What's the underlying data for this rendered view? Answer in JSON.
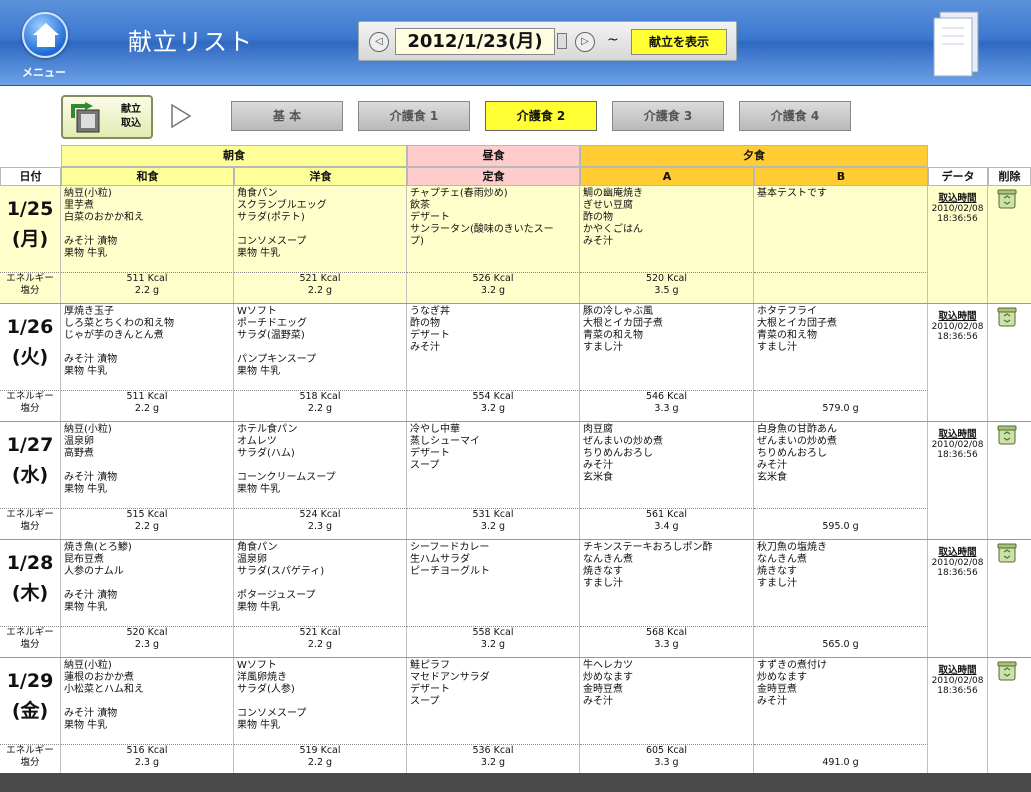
{
  "header": {
    "menu_label": "メニュー",
    "title": "献立リスト",
    "date": "2012/1/23(月)",
    "tilde": "~",
    "show_button": "献立を表示"
  },
  "toolbar": {
    "import_label_1": "献立",
    "import_label_2": "取込",
    "tabs": [
      "基 本",
      "介護食 1",
      "介護食 2",
      "介護食 3",
      "介護食 4"
    ],
    "active_tab": "介護食 2"
  },
  "table_headers": {
    "breakfast": "朝食",
    "lunch": "昼食",
    "dinner": "夕食",
    "date_col": "日付",
    "japanese": "和食",
    "western": "洋食",
    "set_meal": "定食",
    "a": "A",
    "b": "B",
    "data": "データ",
    "delete": "削除",
    "energy": "エネルギー",
    "salt": "塩分",
    "import_time": "取込時間"
  },
  "colors": {
    "breakfast_bg": "#ffff99",
    "lunch_bg": "#ffcccc",
    "dinner_bg": "#ffcc33",
    "highlight_row": "#ffffcc",
    "active_tab": "#ffff33"
  },
  "days": [
    {
      "date": "1/25",
      "weekday": "(月)",
      "highlight": true,
      "japanese": "納豆(小粒)\n里芋煮\n白菜のおかか和え\n\nみそ汁 漬物\n果物 牛乳",
      "western": "角食パン\nスクランブルエッグ\nサラダ(ポテト)\n\nコンソメスープ\n果物 牛乳",
      "set_meal": "チャプチェ(春雨炒め)\n飲茶\nデザート\nサンラータン(酸味のきいたスー\nプ)",
      "a": "鯛の幽庵焼き\nぎせい豆腐\n酢の物\nかやくごはん\nみそ汁",
      "b": "基本テストです",
      "energy": [
        "511 Kcal",
        "521 Kcal",
        "526 Kcal",
        "520 Kcal",
        ""
      ],
      "salt": [
        "2.2 g",
        "2.2 g",
        "3.2 g",
        "3.5 g",
        ""
      ],
      "import_date": "2010/02/08",
      "import_time": "18:36:56"
    },
    {
      "date": "1/26",
      "weekday": "(火)",
      "highlight": false,
      "japanese": "厚焼き玉子\nしろ菜とちくわの和え物\nじゃが芋のきんとん煮\n\nみそ汁 漬物\n果物 牛乳",
      "western": "Wソフト\nポーチドエッグ\nサラダ(温野菜)\n\nパンプキンスープ\n果物 牛乳",
      "set_meal": "うなぎ丼\n酢の物\nデザート\nみそ汁",
      "a": "豚の冷しゃぶ風\n大根とイカ団子煮\n青菜の和え物\nすまし汁",
      "b": "ホタテフライ\n大根とイカ団子煮\n青菜の和え物\nすまし汁",
      "energy": [
        "511 Kcal",
        "518 Kcal",
        "554 Kcal",
        "546 Kcal",
        ""
      ],
      "salt": [
        "2.2 g",
        "2.2 g",
        "3.2 g",
        "3.3 g",
        "579.0 g"
      ],
      "import_date": "2010/02/08",
      "import_time": "18:36:56"
    },
    {
      "date": "1/27",
      "weekday": "(水)",
      "highlight": false,
      "japanese": "納豆(小粒)\n温泉卵\n高野煮\n\nみそ汁 漬物\n果物 牛乳",
      "western": "ホテル食パン\nオムレツ\nサラダ(ハム)\n\nコーンクリームスープ\n果物 牛乳",
      "set_meal": "冷やし中華\n蒸しシューマイ\nデザート\nスープ",
      "a": "肉豆腐\nぜんまいの炒め煮\nちりめんおろし\nみそ汁\n玄米食",
      "b": "白身魚の甘酢あん\nぜんまいの炒め煮\nちりめんおろし\nみそ汁\n玄米食",
      "energy": [
        "515 Kcal",
        "524 Kcal",
        "531 Kcal",
        "561 Kcal",
        ""
      ],
      "salt": [
        "2.2 g",
        "2.3 g",
        "3.2 g",
        "3.4 g",
        "595.0 g"
      ],
      "import_date": "2010/02/08",
      "import_time": "18:36:56"
    },
    {
      "date": "1/28",
      "weekday": "(木)",
      "highlight": false,
      "japanese": "焼き魚(とろ鯵)\n昆布豆煮\n人参のナムル\n\nみそ汁 漬物\n果物 牛乳",
      "western": "角食パン\n温泉卵\nサラダ(スパゲティ)\n\nポタージュスープ\n果物 牛乳",
      "set_meal": "シーフードカレー\n生ハムサラダ\nピーチヨーグルト",
      "a": "チキンステーキおろしポン酢\nなんきん煮\n焼きなす\nすまし汁",
      "b": "秋刀魚の塩焼き\nなんきん煮\n焼きなす\nすまし汁",
      "energy": [
        "520 Kcal",
        "521 Kcal",
        "558 Kcal",
        "568 Kcal",
        ""
      ],
      "salt": [
        "2.3 g",
        "2.2 g",
        "3.2 g",
        "3.3 g",
        "565.0 g"
      ],
      "import_date": "2010/02/08",
      "import_time": "18:36:56"
    },
    {
      "date": "1/29",
      "weekday": "(金)",
      "highlight": false,
      "japanese": "納豆(小粒)\n蓮根のおかか煮\n小松菜とハム和え\n\nみそ汁 漬物\n果物 牛乳",
      "western": "Wソフト\n洋風卵焼き\nサラダ(人参)\n\nコンソメスープ\n果物 牛乳",
      "set_meal": "鮭ピラフ\nマセドアンサラダ\nデザート\nスープ",
      "a": "牛ヘレカツ\n炒めなます\n金時豆煮\nみそ汁",
      "b": "すずきの煮付け\n炒めなます\n金時豆煮\nみそ汁",
      "energy": [
        "516 Kcal",
        "519 Kcal",
        "536 Kcal",
        "605 Kcal",
        ""
      ],
      "salt": [
        "2.3 g",
        "2.2 g",
        "3.2 g",
        "3.3 g",
        "491.0 g"
      ],
      "import_date": "2010/02/08",
      "import_time": "18:36:56"
    }
  ]
}
